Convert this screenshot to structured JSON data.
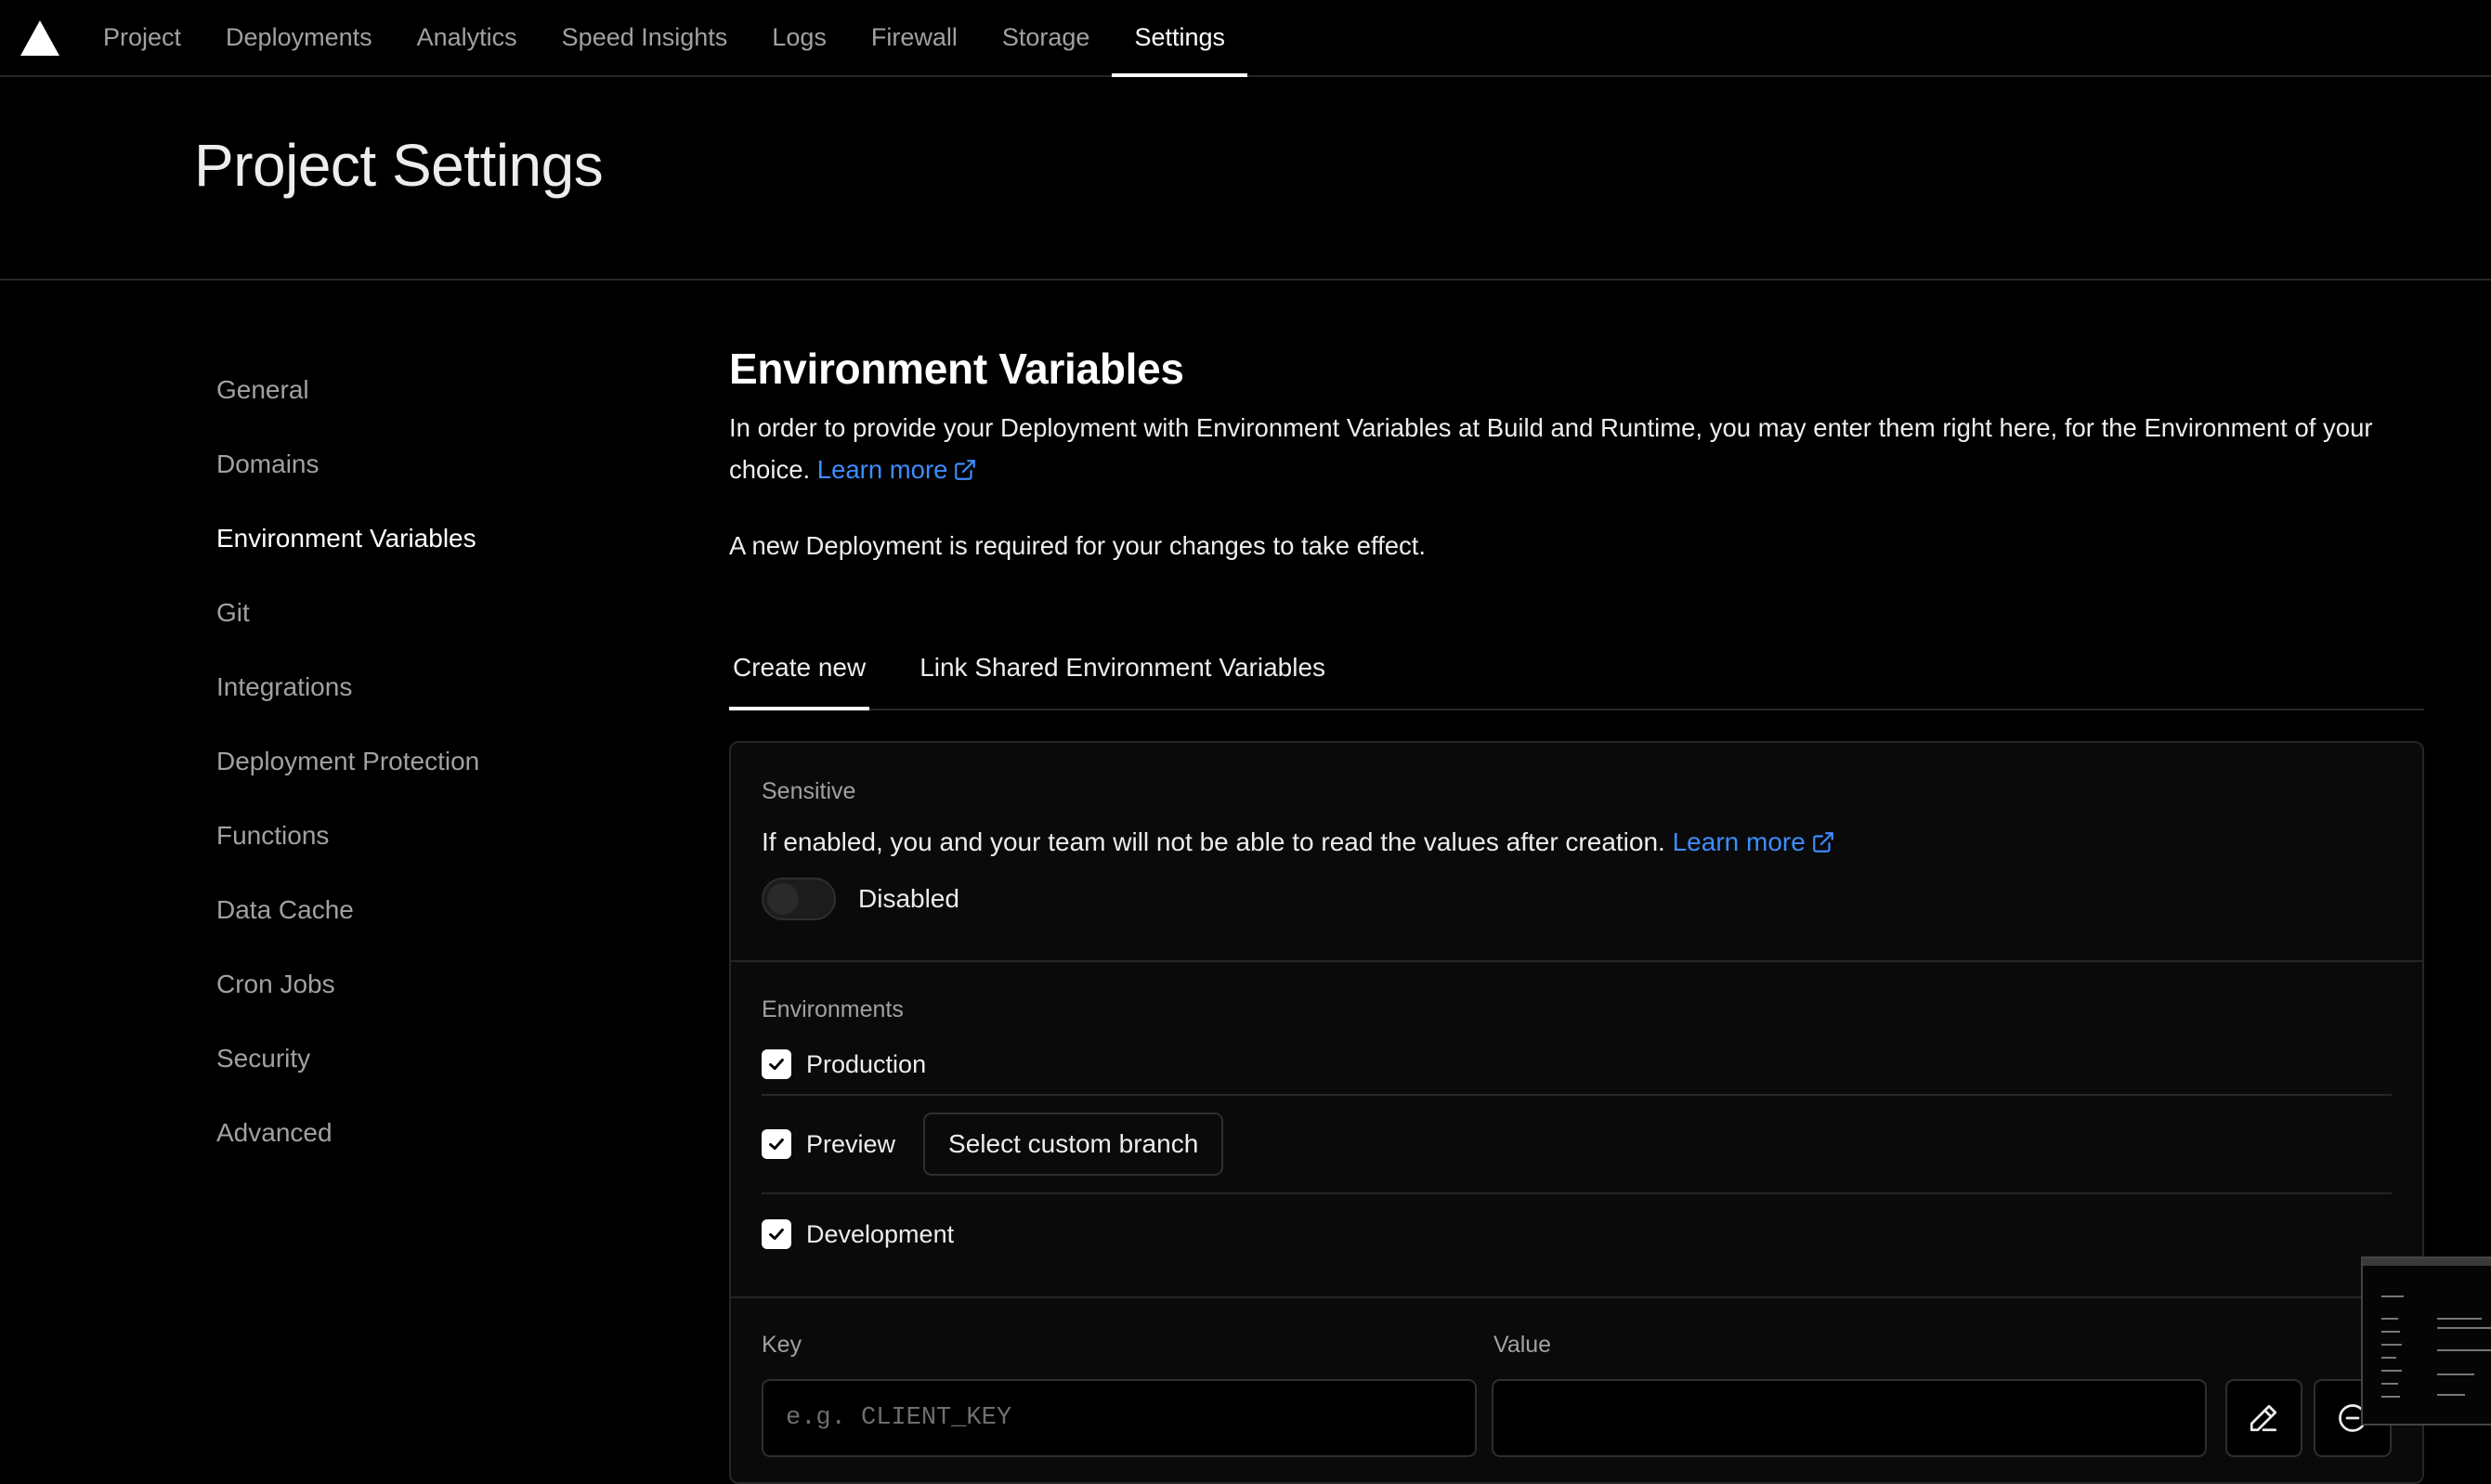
{
  "topnav": {
    "items": [
      "Project",
      "Deployments",
      "Analytics",
      "Speed Insights",
      "Logs",
      "Firewall",
      "Storage",
      "Settings"
    ],
    "active": "Settings"
  },
  "header": {
    "title": "Project Settings"
  },
  "sidebar": {
    "items": [
      {
        "label": "General"
      },
      {
        "label": "Domains"
      },
      {
        "label": "Environment Variables"
      },
      {
        "label": "Git"
      },
      {
        "label": "Integrations"
      },
      {
        "label": "Deployment Protection"
      },
      {
        "label": "Functions"
      },
      {
        "label": "Data Cache"
      },
      {
        "label": "Cron Jobs"
      },
      {
        "label": "Security"
      },
      {
        "label": "Advanced"
      }
    ],
    "active": "Environment Variables"
  },
  "main": {
    "title": "Environment Variables",
    "description": "In order to provide your Deployment with Environment Variables at Build and Runtime, you may enter them right here, for the Environment of your choice.",
    "learn_more": "Learn more",
    "note": "A new Deployment is required for your changes to take effect.",
    "tabs": [
      {
        "label": "Create new"
      },
      {
        "label": "Link Shared Environment Variables"
      }
    ],
    "sensitive": {
      "label": "Sensitive",
      "description": "If enabled, you and your team will not be able to read the values after creation.",
      "learn_more": "Learn more",
      "toggle_label": "Disabled"
    },
    "environments": {
      "label": "Environments",
      "production": "Production",
      "preview": "Preview",
      "select_branch": "Select custom branch",
      "development": "Development"
    },
    "kv": {
      "key_label": "Key",
      "value_label": "Value",
      "key_placeholder": "e.g. CLIENT_KEY",
      "value": ""
    }
  },
  "colors": {
    "accent_link": "#3d8dff",
    "background": "#000000",
    "border": "#262626"
  },
  "icons": [
    "vercel-triangle-icon",
    "external-link-icon",
    "checkmark-icon",
    "pencil-icon",
    "minus-circle-icon"
  ]
}
